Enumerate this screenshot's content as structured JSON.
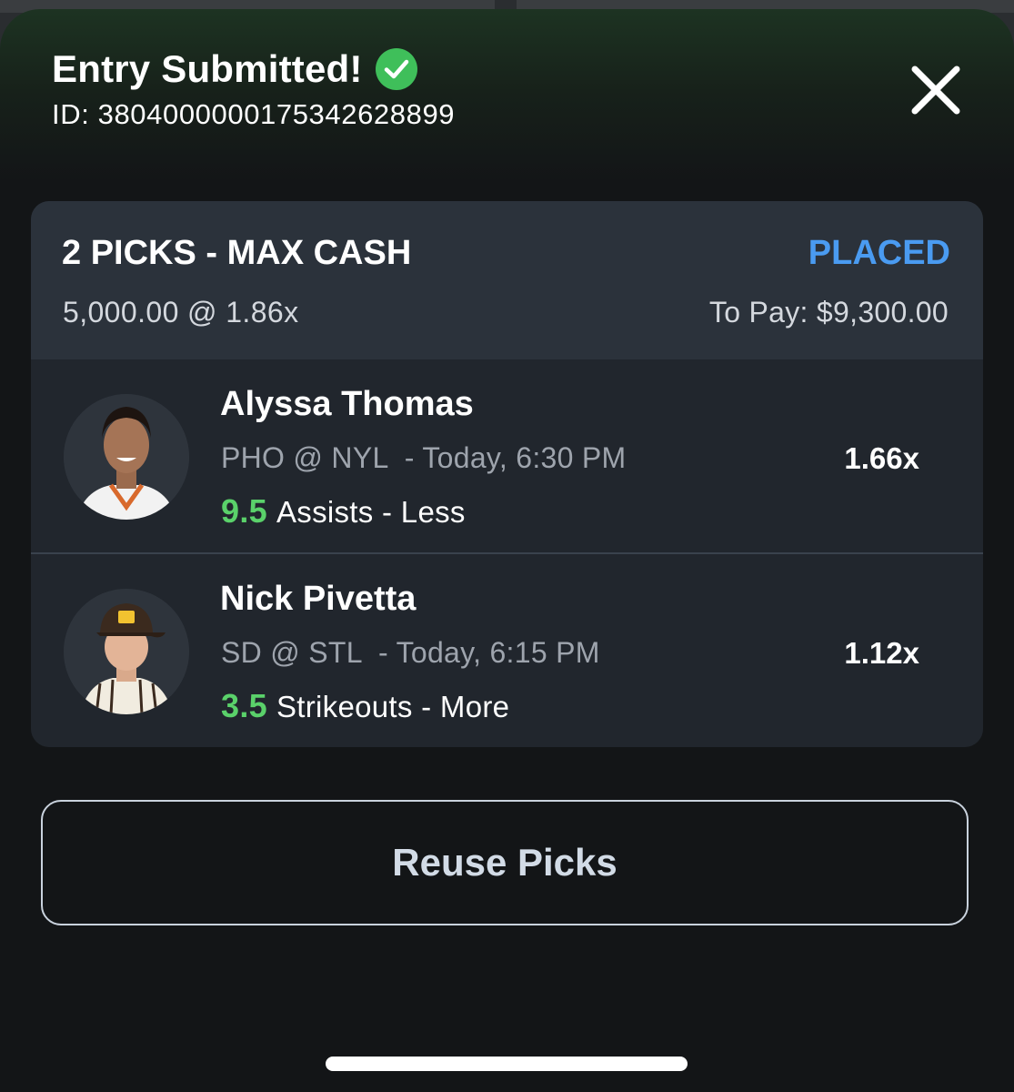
{
  "header": {
    "title": "Entry Submitted!",
    "entry_id": "ID: 3804000000175342628899"
  },
  "entry": {
    "type": "2 PICKS - MAX CASH",
    "stake": "5,000.00 @ 1.86x",
    "status": "PLACED",
    "to_pay": "To Pay: $9,300.00",
    "status_color": "#4a9bf1"
  },
  "picks": [
    {
      "player": "Alyssa Thomas",
      "matchup": "PHO @ NYL  - Today, 6:30 PM",
      "line": "9.5",
      "stat": "Assists - Less",
      "multiplier": "1.66x"
    },
    {
      "player": "Nick Pivetta",
      "matchup": "SD @ STL  - Today, 6:15 PM",
      "line": "3.5",
      "stat": "Strikeouts - More",
      "multiplier": "1.12x"
    }
  ],
  "actions": {
    "reuse_label": "Reuse Picks"
  },
  "colors": {
    "accent_green": "#5ad16a",
    "check_green": "#3fbf5a"
  },
  "icons": {
    "title_status": "check-circle-icon",
    "close": "close-icon"
  }
}
